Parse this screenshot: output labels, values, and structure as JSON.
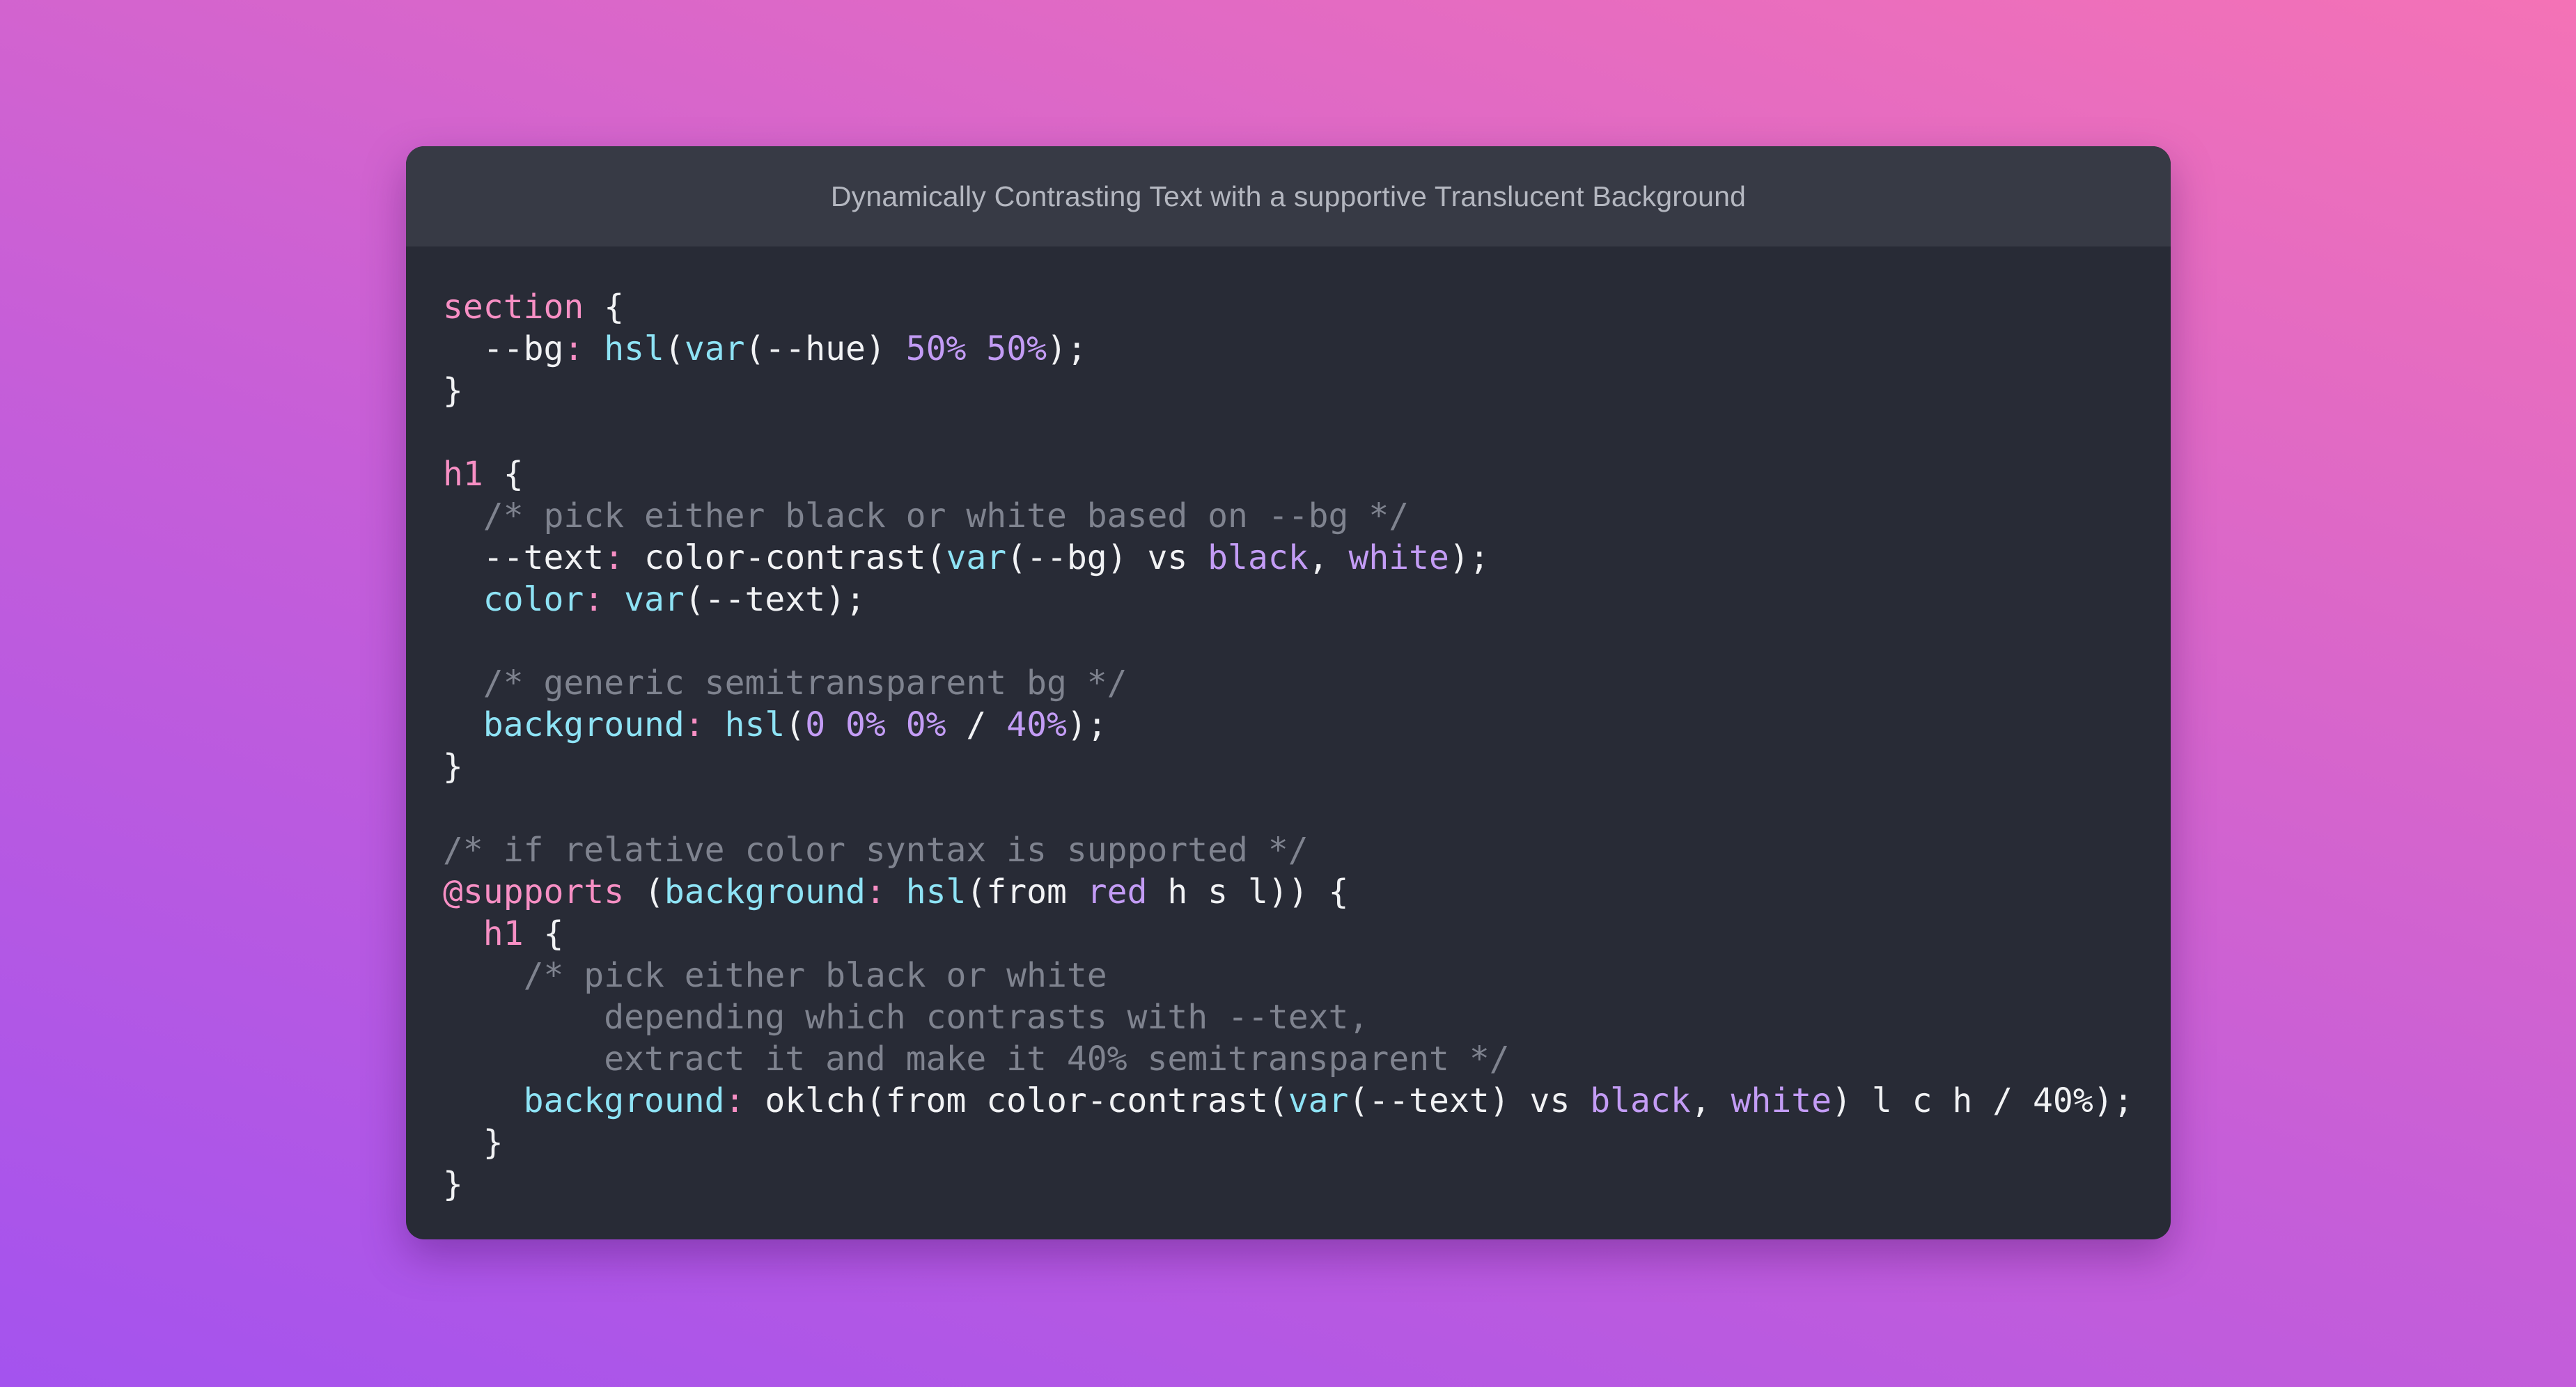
{
  "window": {
    "title": "Dynamically Contrasting Text with a supportive Translucent Background"
  },
  "code": {
    "lines": [
      [
        {
          "t": "section",
          "c": "sel"
        },
        {
          "t": " {",
          "c": ""
        }
      ],
      [
        {
          "t": "  --bg",
          "c": ""
        },
        {
          "t": ":",
          "c": "colon"
        },
        {
          "t": " ",
          "c": ""
        },
        {
          "t": "hsl",
          "c": "fn"
        },
        {
          "t": "(",
          "c": ""
        },
        {
          "t": "var",
          "c": "fn"
        },
        {
          "t": "(--hue) ",
          "c": ""
        },
        {
          "t": "50%",
          "c": "num"
        },
        {
          "t": " ",
          "c": ""
        },
        {
          "t": "50%",
          "c": "num"
        },
        {
          "t": ");",
          "c": ""
        }
      ],
      [
        {
          "t": "}",
          "c": ""
        }
      ],
      [],
      [
        {
          "t": "h1",
          "c": "sel"
        },
        {
          "t": " {",
          "c": ""
        }
      ],
      [
        {
          "t": "  /* pick either black or white based on --bg */",
          "c": "cm"
        }
      ],
      [
        {
          "t": "  --text",
          "c": ""
        },
        {
          "t": ":",
          "c": "colon"
        },
        {
          "t": " color-contrast(",
          "c": ""
        },
        {
          "t": "var",
          "c": "fn"
        },
        {
          "t": "(--bg) vs ",
          "c": ""
        },
        {
          "t": "black",
          "c": "kw"
        },
        {
          "t": ", ",
          "c": ""
        },
        {
          "t": "white",
          "c": "kw"
        },
        {
          "t": ");",
          "c": ""
        }
      ],
      [
        {
          "t": "  ",
          "c": ""
        },
        {
          "t": "color",
          "c": "prop"
        },
        {
          "t": ":",
          "c": "colon"
        },
        {
          "t": " ",
          "c": ""
        },
        {
          "t": "var",
          "c": "fn"
        },
        {
          "t": "(--text);",
          "c": ""
        }
      ],
      [],
      [
        {
          "t": "  /* generic semitransparent bg */",
          "c": "cm"
        }
      ],
      [
        {
          "t": "  ",
          "c": ""
        },
        {
          "t": "background",
          "c": "prop"
        },
        {
          "t": ":",
          "c": "colon"
        },
        {
          "t": " ",
          "c": ""
        },
        {
          "t": "hsl",
          "c": "fn"
        },
        {
          "t": "(",
          "c": ""
        },
        {
          "t": "0",
          "c": "num"
        },
        {
          "t": " ",
          "c": ""
        },
        {
          "t": "0%",
          "c": "num"
        },
        {
          "t": " ",
          "c": ""
        },
        {
          "t": "0%",
          "c": "num"
        },
        {
          "t": " / ",
          "c": ""
        },
        {
          "t": "40%",
          "c": "num"
        },
        {
          "t": ");",
          "c": ""
        }
      ],
      [
        {
          "t": "}",
          "c": ""
        }
      ],
      [],
      [
        {
          "t": "/* if relative color syntax is supported */",
          "c": "cm"
        }
      ],
      [
        {
          "t": "@supports",
          "c": "at"
        },
        {
          "t": " (",
          "c": ""
        },
        {
          "t": "background",
          "c": "prop"
        },
        {
          "t": ":",
          "c": "colon"
        },
        {
          "t": " ",
          "c": ""
        },
        {
          "t": "hsl",
          "c": "fn"
        },
        {
          "t": "(from ",
          "c": ""
        },
        {
          "t": "red",
          "c": "kw"
        },
        {
          "t": " h s l)) {",
          "c": ""
        }
      ],
      [
        {
          "t": "  ",
          "c": ""
        },
        {
          "t": "h1",
          "c": "sel"
        },
        {
          "t": " {",
          "c": ""
        }
      ],
      [
        {
          "t": "    /* pick either black or white",
          "c": "cm"
        }
      ],
      [
        {
          "t": "        depending which contrasts with --text,",
          "c": "cm"
        }
      ],
      [
        {
          "t": "        extract it and make it 40% semitransparent */",
          "c": "cm"
        }
      ],
      [
        {
          "t": "    ",
          "c": ""
        },
        {
          "t": "background",
          "c": "prop"
        },
        {
          "t": ":",
          "c": "colon"
        },
        {
          "t": " oklch(from color-contrast(",
          "c": ""
        },
        {
          "t": "var",
          "c": "fn"
        },
        {
          "t": "(--text) vs ",
          "c": ""
        },
        {
          "t": "black",
          "c": "kw"
        },
        {
          "t": ", ",
          "c": ""
        },
        {
          "t": "white",
          "c": "kw"
        },
        {
          "t": ") l c h / 40%);",
          "c": ""
        }
      ],
      [
        {
          "t": "  }",
          "c": ""
        }
      ],
      [
        {
          "t": "}",
          "c": ""
        }
      ]
    ]
  },
  "colors": {
    "selector": "#f78fc4",
    "property": "#8ee3f5",
    "value_keyword": "#c39cf5",
    "comment": "#7f838f",
    "window_bg": "#282b36",
    "titlebar_bg": "#373a45"
  }
}
